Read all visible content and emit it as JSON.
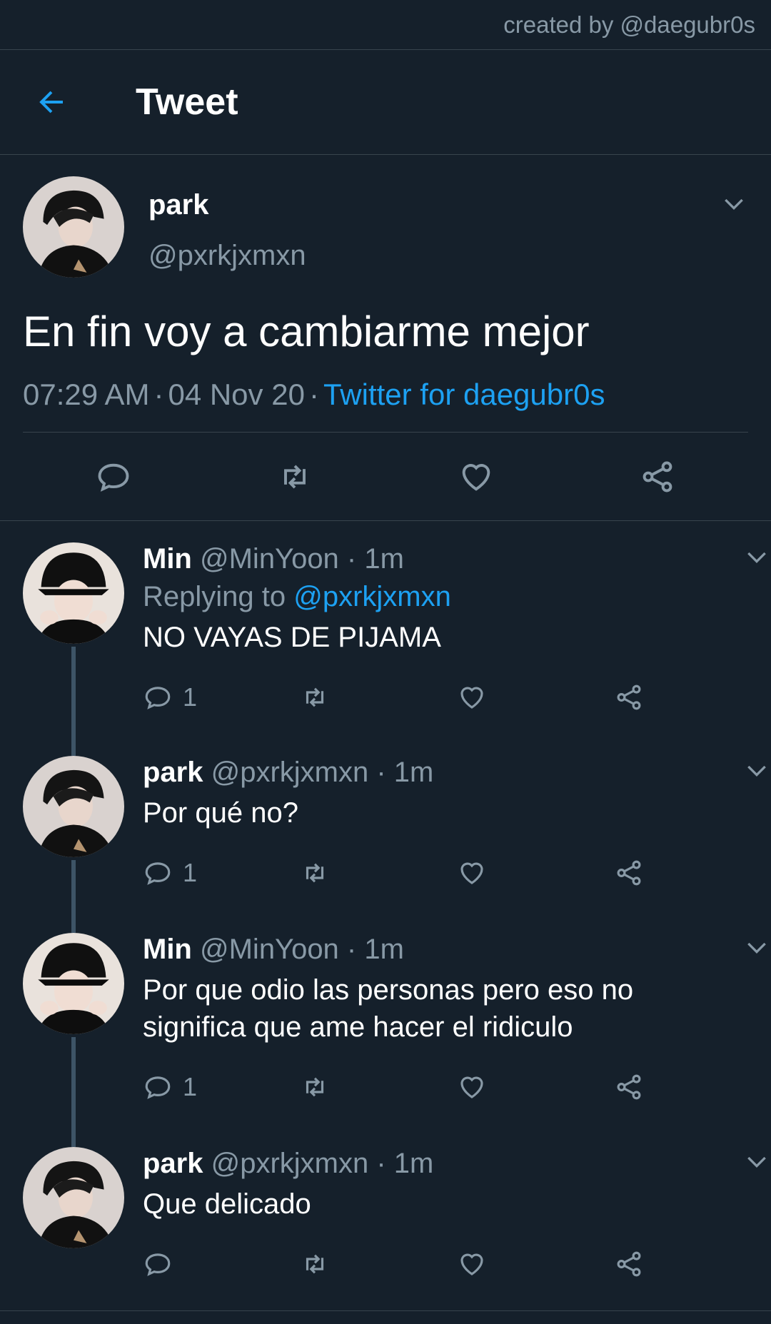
{
  "credit": "created by @daegubr0s",
  "header": {
    "title": "Tweet"
  },
  "colors": {
    "background": "#15202b",
    "accent": "#1da1f2",
    "muted": "#8899a6",
    "divider": "#38444d",
    "thread_line": "#3d5466"
  },
  "main_tweet": {
    "name": "park",
    "handle": "@pxrkjxmxn",
    "text": "En fin voy a cambiarme mejor",
    "time": "07:29 AM",
    "date": "04 Nov 20",
    "source": "Twitter for daegubr0s",
    "sep": "·"
  },
  "replies": [
    {
      "name": "Min",
      "handle": "@MinYoon · 1m",
      "replying_prefix": "Replying to ",
      "replying_handle": "@pxrkjxmxn",
      "text": "NO VAYAS DE PIJAMA",
      "reply_count": "1",
      "avatar": "min"
    },
    {
      "name": "park",
      "handle": "@pxrkjxmxn · 1m",
      "text": "Por qué no?",
      "reply_count": "1",
      "avatar": "park"
    },
    {
      "name": "Min",
      "handle": "@MinYoon · 1m",
      "text": "Por que odio las personas pero eso no significa que ame hacer el ridiculo",
      "reply_count": "1",
      "avatar": "min"
    },
    {
      "name": "park",
      "handle": "@pxrkjxmxn · 1m",
      "text": "Que delicado",
      "reply_count": "",
      "avatar": "park"
    }
  ],
  "icons": [
    "back-arrow-icon",
    "chevron-down-icon",
    "reply-icon",
    "retweet-icon",
    "like-icon",
    "share-icon"
  ]
}
